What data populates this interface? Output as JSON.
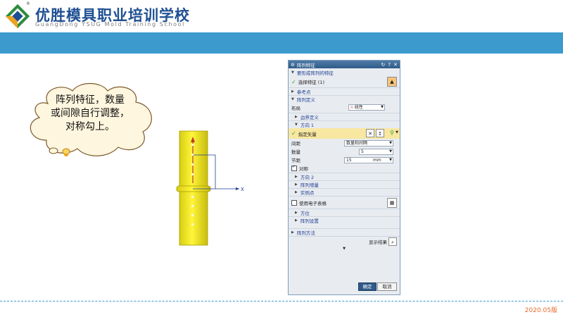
{
  "header": {
    "school_name_cn": "优胜模具职业培训学校",
    "school_name_en": "GuangDong YSUG Mold Training School",
    "registered_mark": "®"
  },
  "cloud": {
    "text_lines": [
      "阵列特征，数量",
      "或间隙自行调整，",
      "对称勾上。"
    ]
  },
  "model": {
    "axis_label": "X"
  },
  "dialog": {
    "title": "阵列特征",
    "title_buttons": [
      "↻",
      "?",
      "✕"
    ],
    "section_feature": "要形成阵列的特征",
    "select_feature": "选择特征 (1)",
    "section_ref": "参考点",
    "section_def": "阵列定义",
    "layout_label": "布局",
    "layout_value": "线性",
    "boundary": "边界定义",
    "direction1": "方向 1",
    "specify_vector": "指定矢量",
    "spacing_label": "间距",
    "spacing_value": "数量和间隔",
    "count_label": "数量",
    "count_value": "5",
    "pitch_label": "节距",
    "pitch_value": "15",
    "pitch_unit": "mm",
    "symmetric_label": "对称",
    "symmetric_checked": true,
    "direction2": "方向 2",
    "pattern_increment": "阵列增量",
    "instance_point": "实例点",
    "use_spreadsheet": "使用电子表格",
    "orientation": "方位",
    "pattern_settings": "阵列设置",
    "pattern_method": "阵列方法",
    "show_result": "显示结果",
    "ok_label": "确定",
    "cancel_label": "取消"
  },
  "footer": {
    "version": "2020.05版"
  },
  "colors": {
    "band": "#3c9bcc",
    "brand_blue": "#1e4f92",
    "accent_orange": "#e46c2c",
    "model_yellow": "#f2e92a"
  }
}
